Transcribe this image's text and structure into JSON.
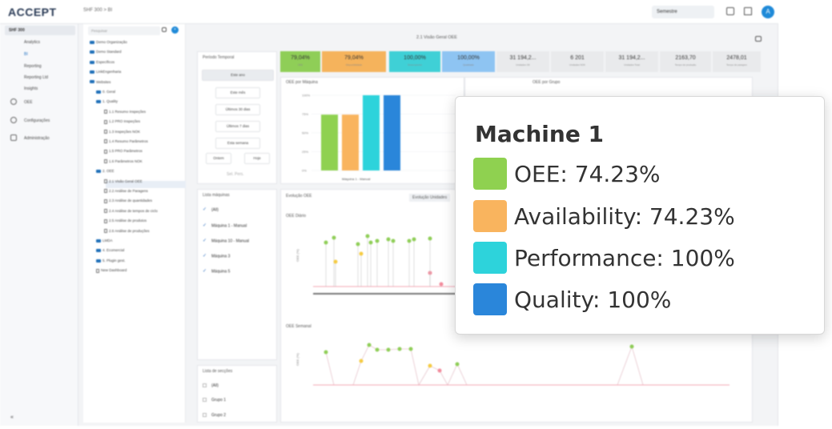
{
  "app": {
    "logo": "ACCEPT",
    "breadcrumb": "SHF 300 > BI",
    "period_select": "Semestre",
    "avatar_initial": "A"
  },
  "nav": {
    "selected": "SHF 300",
    "items": [
      "Analytics",
      "BI",
      "Reporting",
      "Reporting Ltd",
      "Insights",
      "OEE",
      "Configurações",
      "Administração"
    ]
  },
  "tree": {
    "search_placeholder": "Pesquisar",
    "items": [
      "Demo Organização",
      "Demo Standard",
      "Específicos",
      "LinkEngenharia",
      "Websites",
      "0. Geral",
      "1. Quality",
      "1.1 Resumo Inspeções",
      "1.2 PRO Inspeções",
      "1.3 Inspeções NOK",
      "1.4 Resumo Parâmetros",
      "1.5 PRO Parâmetros",
      "1.6 Parâmetros NOK",
      "2. OEE",
      "2.1 Visão Geral OEE",
      "2.2 Análise de Paragens",
      "2.3 Análise de quantidades",
      "2.4 Análise de tempos de ciclo",
      "2.5 Análise de produtos",
      "2.6 Análise de produções",
      "LMDA",
      "4. Ecomercial",
      "5. Plugin gest.",
      "New Dashboard"
    ]
  },
  "page": {
    "title": "2.1 Visão Geral OEE"
  },
  "filters": {
    "title": "Período Temporal",
    "buttons": [
      "Este ano",
      "Este mês",
      "Últimos 30 dias",
      "Últimos 7 dias",
      "Esta semana"
    ],
    "small_buttons": [
      "Ontem",
      "Hoje"
    ],
    "extra": "Sel. Pers."
  },
  "machines": {
    "title": "Lista máquinas",
    "items": [
      "(All)",
      "Máquina 1 - Manual",
      "Máquina 10 - Manual",
      "Máquina 3",
      "Máquina 5"
    ]
  },
  "sections": {
    "title": "Lista de secções",
    "items": [
      "(All)",
      "Grupo 1",
      "Grupo 2"
    ]
  },
  "kpis": [
    {
      "value": "79,04%",
      "label": "OEE",
      "color": "#8fce57"
    },
    {
      "value": "79,04%",
      "label": "Disponibilidade",
      "color": "#f5b35c"
    },
    {
      "value": "100,00%",
      "label": "Desempenho",
      "color": "#3fd0d6"
    },
    {
      "value": "100,00%",
      "label": "Qualidade",
      "color": "#8ec4f2"
    },
    {
      "value": "31 194,2...",
      "label": "Unidades OK",
      "color": "#e9eaec"
    },
    {
      "value": "6 201",
      "label": "Unidades NOK",
      "color": "#e9eaec"
    },
    {
      "value": "31 194,2...",
      "label": "Unidades Total",
      "color": "#e9eaec"
    },
    {
      "value": "2163,70",
      "label": "Tempo de produção",
      "color": "#e9eaec"
    },
    {
      "value": "2478,01",
      "label": "Tempo de paragem",
      "color": "#e9eaec"
    }
  ],
  "charts": {
    "bar_title": "OEE por Máquina",
    "bar_tab2": "OEE por Grupo",
    "bar_x_label": "Máquina 1 - Manual",
    "bar_y_ticks": [
      "100%",
      "75%",
      "50%",
      "25%",
      "0%"
    ],
    "evolution_tab": "Evolução OEE",
    "evolution_tab2": "Evolução Unidades",
    "daily_title": "OEE Diário",
    "weekly_title": "OEE Semanal",
    "y_axis_label": "OEE (%)"
  },
  "tooltip": {
    "title": "Machine 1",
    "rows": [
      {
        "label": "OEE: 74.23%",
        "color": "#8fd150"
      },
      {
        "label": "Availability: 74.23%",
        "color": "#f9b45e"
      },
      {
        "label": "Performance: 100%",
        "color": "#2dd3db"
      },
      {
        "label": "Quality: 100%",
        "color": "#2a86da"
      }
    ]
  },
  "chart_data": {
    "type": "bar",
    "categories": [
      "Máquina 1 - Manual"
    ],
    "series": [
      {
        "name": "OEE",
        "values": [
          74.23
        ]
      },
      {
        "name": "Availability",
        "values": [
          74.23
        ]
      },
      {
        "name": "Performance",
        "values": [
          100
        ]
      },
      {
        "name": "Quality",
        "values": [
          100
        ]
      }
    ],
    "ylim": [
      0,
      100
    ],
    "ylabel": ""
  }
}
